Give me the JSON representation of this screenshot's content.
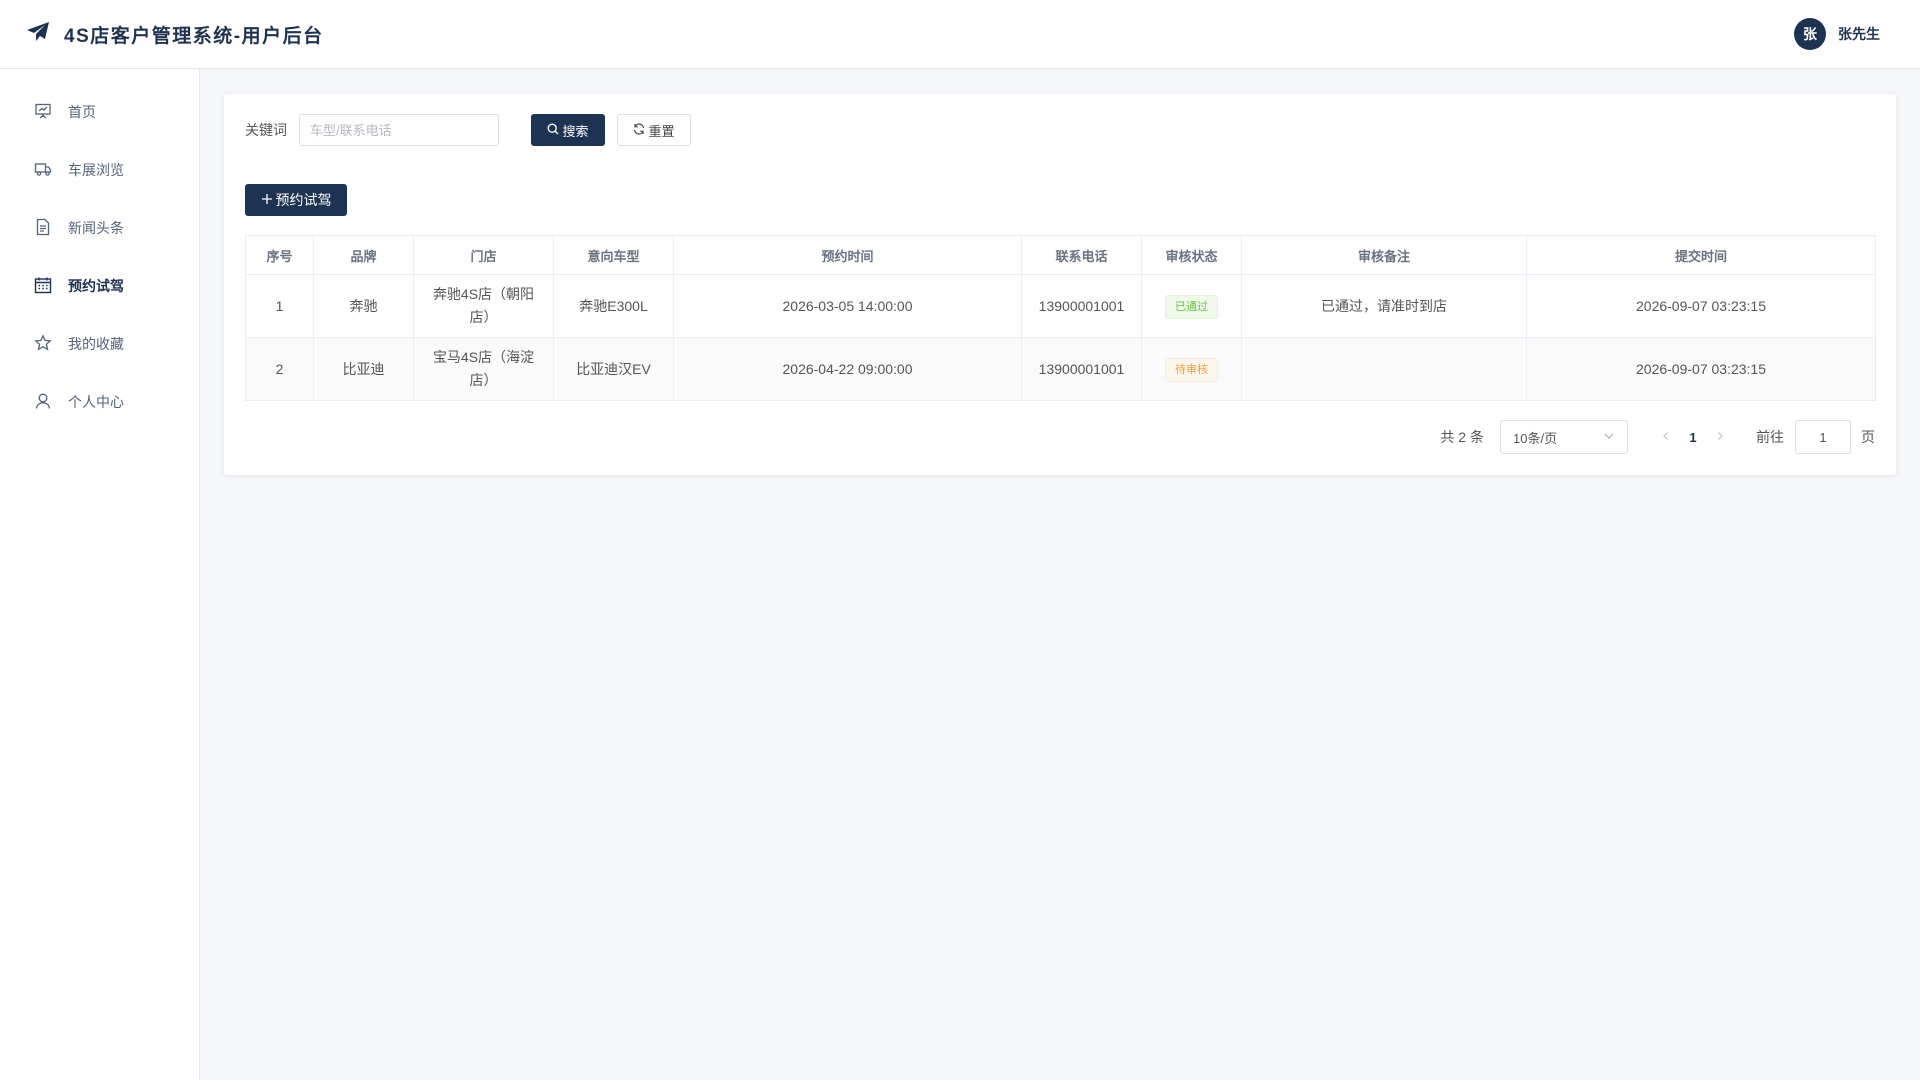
{
  "header": {
    "title": "4S店客户管理系统-用户后台",
    "logo_icon": "paper-plane-icon",
    "user": {
      "avatar_text": "张",
      "name": "张先生"
    }
  },
  "sidebar": {
    "items": [
      {
        "label": "首页",
        "icon": "presentation-icon",
        "active": false
      },
      {
        "label": "车展浏览",
        "icon": "truck-icon",
        "active": false
      },
      {
        "label": "新闻头条",
        "icon": "document-icon",
        "active": false
      },
      {
        "label": "预约试驾",
        "icon": "calendar-icon",
        "active": true
      },
      {
        "label": "我的收藏",
        "icon": "star-icon",
        "active": false
      },
      {
        "label": "个人中心",
        "icon": "user-icon",
        "active": false
      }
    ]
  },
  "search": {
    "label": "关键词",
    "placeholder": "车型/联系电话",
    "value": "",
    "search_button": "搜索",
    "reset_button": "重置"
  },
  "toolbar": {
    "add_button": "预约试驾"
  },
  "table": {
    "columns": [
      "序号",
      "品牌",
      "门店",
      "意向车型",
      "预约时间",
      "联系电话",
      "审核状态",
      "审核备注",
      "提交时间"
    ],
    "rows": [
      {
        "index": "1",
        "brand": "奔驰",
        "store": "奔驰4S店（朝阳店）",
        "model": "奔驰E300L",
        "appointment_time": "2026-03-05 14:00:00",
        "phone": "13900001001",
        "status": "已通过",
        "remark": "已通过，请准时到店",
        "submit_time": "2026-09-07 03:23:15"
      },
      {
        "index": "2",
        "brand": "比亚迪",
        "store": "宝马4S店（海淀店）",
        "model": "比亚迪汉EV",
        "appointment_time": "2026-04-22 09:00:00",
        "phone": "13900001001",
        "status": "待审核",
        "remark": "",
        "submit_time": "2026-09-07 03:23:15"
      }
    ]
  },
  "pagination": {
    "total_text": "共 2 条",
    "page_size": "10条/页",
    "current_page": "1",
    "goto_label": "前往",
    "goto_value": "1",
    "page_suffix": "页"
  },
  "colors": {
    "primary": "#1e3352",
    "approved": "#67c23a",
    "pending": "#e6a23c"
  }
}
